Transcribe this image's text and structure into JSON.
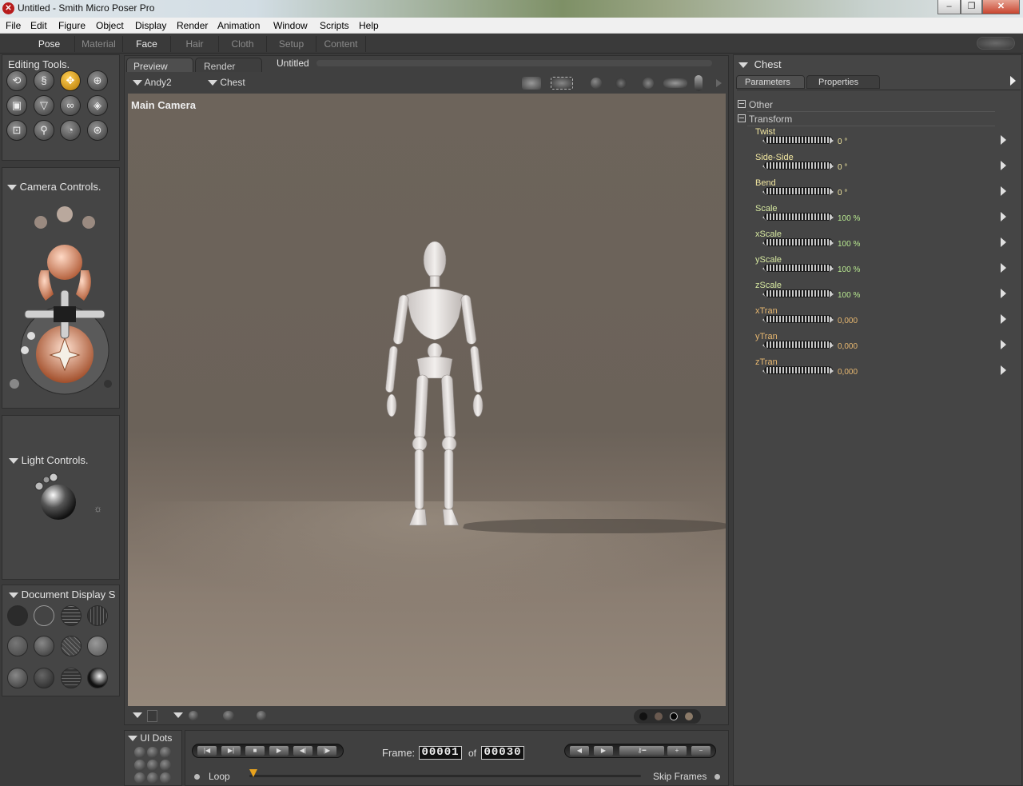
{
  "window": {
    "title": "Untitled - Smith Micro Poser Pro",
    "minimize": "–",
    "maximize": "❐",
    "close": "✕"
  },
  "menu": [
    "File",
    "Edit",
    "Figure",
    "Object",
    "Display",
    "Render",
    "Animation",
    "Window",
    "Scripts",
    "Help"
  ],
  "rooms": [
    "Pose",
    "Material",
    "Face",
    "Hair",
    "Cloth",
    "Setup",
    "Content"
  ],
  "editing_tools": {
    "title": "Editing Tools."
  },
  "camera_controls": {
    "title": "Camera Controls."
  },
  "light_controls": {
    "title": "Light Controls."
  },
  "document_display": {
    "title": "Document Display S"
  },
  "ui_dots": {
    "title": "UI Dots"
  },
  "document": {
    "tabs": [
      "Preview",
      "Render"
    ],
    "doc_title": "Untitled",
    "figure": "Andy2",
    "actor": "Chest",
    "camera_label": "Main Camera"
  },
  "parameters": {
    "actor": "Chest",
    "tabs": [
      "Parameters",
      "Properties"
    ],
    "groups": [
      "Other",
      "Transform"
    ],
    "rows": [
      {
        "name": "Twist",
        "value": "0 °"
      },
      {
        "name": "Side-Side",
        "value": "0 °"
      },
      {
        "name": "Bend",
        "value": "0 °"
      },
      {
        "name": "Scale",
        "value": "100 %"
      },
      {
        "name": "xScale",
        "value": "100 %"
      },
      {
        "name": "yScale",
        "value": "100 %"
      },
      {
        "name": "zScale",
        "value": "100 %"
      },
      {
        "name": "xTran",
        "value": "0,000"
      },
      {
        "name": "yTran",
        "value": "0,000"
      },
      {
        "name": "zTran",
        "value": "0,000"
      }
    ],
    "colors": {
      "rotation_name": "#f1e6a0",
      "scale_name": "#d6e8a0",
      "trans_name": "#e8b870",
      "rotation_value": "#f1e6a0",
      "scale_value": "#b8e890",
      "trans_value": "#e8b870"
    }
  },
  "animation": {
    "frame_label": "Frame:",
    "frame": "00001",
    "of_label": "of",
    "total": "00030",
    "loop_label": "Loop",
    "skip_label": "Skip Frames"
  }
}
